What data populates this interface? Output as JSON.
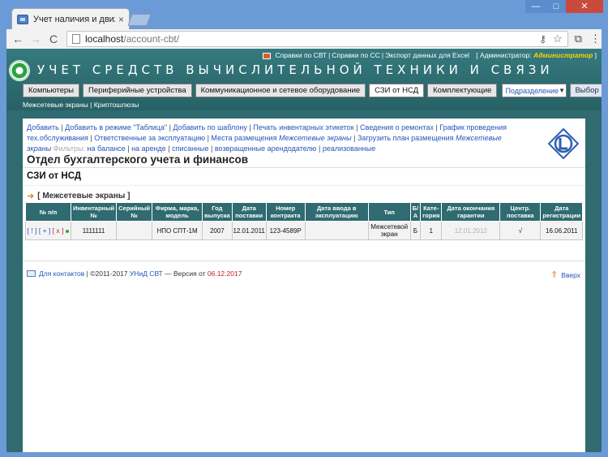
{
  "browser": {
    "tab_title": "Учет наличия и движен",
    "tab_close": "×",
    "url_host": "localhost",
    "url_path": "/account-cbt/",
    "back": "←",
    "forward": "→",
    "reload": "C",
    "key": "⚷",
    "star": "☆",
    "cast": "⧉",
    "menu": "⋮",
    "min": "—",
    "max": "□",
    "close": "✕"
  },
  "header": {
    "links": [
      "Справки по СВТ",
      "Справки по СС",
      "Экспорт данных для Excel"
    ],
    "admin_label": "Администратор:",
    "admin_name": "Администратор",
    "site_title": "УЧЕТ СРЕДСТВ ВЫЧИСЛИТЕЛЬНОЙ ТЕХНИКИ И СВЯЗИ"
  },
  "menu": {
    "items": [
      "Компьютеры",
      "Периферийные устройства",
      "Коммуникационное и сетевое оборудование",
      "СЗИ от НСД",
      "Комплектующие"
    ],
    "dept_select": "Подразделение",
    "choose_button": "Выбор"
  },
  "submenu": {
    "items": [
      "Межсетевые экраны",
      "Криптошлюзы"
    ]
  },
  "actions": {
    "add": "Добавить",
    "add_table": "Добавить в режиме \"Таблица\"",
    "add_template": "Добавить по шаблону",
    "print_labels": "Печать инвентарных этикеток",
    "repairs": "Сведения о ремонтах",
    "schedule": "График проведения тех.обслуживания",
    "responsible": "Ответственные за эксплуатацию",
    "places_prefix": "Места размещения",
    "places_obj": "Межсетевые экраны",
    "upload_prefix": "Загрузить план размещения",
    "upload_obj": "Межсетевые экраны",
    "filters_label": "Фильтры:",
    "filters": [
      "на балансе",
      "на аренде",
      "списанные",
      "возвращенные арендодателю",
      "реализованные"
    ]
  },
  "page": {
    "dept_title": "Отдел бухгалтерского учета и финансов",
    "section_title": "СЗИ от НСД",
    "group_title": "[ Межсетевые экраны ]"
  },
  "table": {
    "headers": [
      "№ п/п",
      "Инвентарный №",
      "Серийный №",
      "Фирма, марка, модель",
      "Год выпуска",
      "Дата поставки",
      "Номер контракта",
      "Дата ввода в эксплуатацию",
      "Тип",
      "Б/А",
      "Кате-гория",
      "Дата окончания гарантии",
      "Центр. поставка",
      "Дата регистрации"
    ],
    "rows": [
      {
        "ctl_view": "[ ! ]",
        "ctl_copy": "[ + ]",
        "ctl_delete": "[ x ]",
        "inventory": "1111111",
        "serial": "",
        "model": "НПО СПТ-1М",
        "year": "2007",
        "delivery_date": "12.01.2011",
        "contract": "123-4589Р",
        "commission_date": "",
        "type": "Межсетевой экран",
        "ba": "Б",
        "category": "1",
        "warranty_end": "12.01.2012",
        "central": "√",
        "reg_date": "16.06.2011"
      }
    ]
  },
  "footer": {
    "contacts": "Для контактов",
    "copyright": "| ©2011-2017",
    "product": "УНиД СВТ",
    "version_text": "— Версия от",
    "version_date": "06.12.2017",
    "up": "Вверх"
  }
}
